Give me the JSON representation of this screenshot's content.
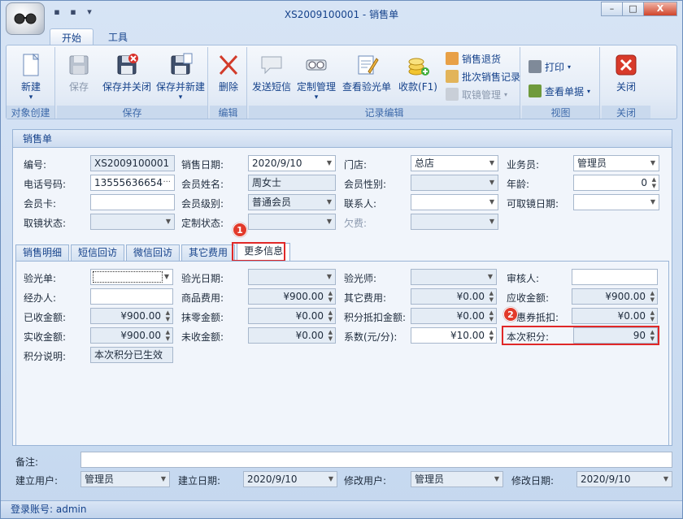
{
  "window": {
    "title": "XS2009100001 - 销售单",
    "min_label": "▭",
    "max_label": "□",
    "close_label": "X"
  },
  "ribbon_tabs": [
    "开始",
    "工具"
  ],
  "ribbon": {
    "groups": {
      "create": "对象创建",
      "save": "保存",
      "edit": "编辑",
      "record_edit": "记录编辑",
      "view": "视图",
      "close": "关闭"
    },
    "new_label": "新建",
    "save_label": "保存",
    "save_close_label": "保存并关闭",
    "save_new_label": "保存并新建",
    "delete_label": "删除",
    "send_sms_label": "发送短信",
    "custom_mgmt_label": "定制管理",
    "view_optometry_label": "查看验光单",
    "receive_label": "收款(F1)",
    "sales_return_label": "销售退货",
    "batch_sales_label": "批次销售记录",
    "cancel_pickup_label": "取镜管理",
    "print_label": "打印",
    "view_doc_label": "查看单据",
    "close_label": "关闭"
  },
  "panel_title": "销售单",
  "header_fields": {
    "code_label": "编号:",
    "code_value": "XS2009100001",
    "sale_date_label": "销售日期:",
    "sale_date_value": "2020/9/10",
    "store_label": "门店:",
    "store_value": "总店",
    "salesman_label": "业务员:",
    "salesman_value": "管理员",
    "phone_label": "电话号码:",
    "phone_value": "13555636654",
    "member_name_label": "会员姓名:",
    "member_name_value": "周女士",
    "member_gender_label": "会员性别:",
    "member_gender_value": "",
    "age_label": "年龄:",
    "age_value": "0",
    "member_card_label": "会员卡:",
    "member_level_label": "会员级别:",
    "member_level_value": "普通会员",
    "contact_label": "联系人:",
    "pickup_date_label": "可取镜日期:",
    "pickup_status_label": "取镜状态:",
    "custom_status_label": "定制状态:",
    "owed_label": "欠费:"
  },
  "tabs": [
    "销售明细",
    "短信回访",
    "微信回访",
    "其它费用",
    "更多信息"
  ],
  "more_info": {
    "optometry_label": "验光单:",
    "optometry_date_label": "验光日期:",
    "optometrist_label": "验光师:",
    "reviewer_label": "审核人:",
    "handler_label": "经办人:",
    "product_fee_label": "商品费用:",
    "product_fee_value": "¥900.00",
    "other_fee_label": "其它费用:",
    "other_fee_value": "¥0.00",
    "receivable_label": "应收金额:",
    "receivable_value": "¥900.00",
    "received_label": "已收金额:",
    "received_value": "¥900.00",
    "rounding_label": "抹零金额:",
    "rounding_value": "¥0.00",
    "points_deduct_label": "积分抵扣金额:",
    "points_deduct_value": "¥0.00",
    "coupon_label": "惠券抵扣:",
    "coupon_value": "¥0.00",
    "actual_label": "实收金额:",
    "actual_value": "¥900.00",
    "unpaid_label": "未收金额:",
    "unpaid_value": "¥0.00",
    "coef_label": "系数(元/分):",
    "coef_value": "¥10.00",
    "points_label": "本次积分:",
    "points_value": "90",
    "points_note_label": "积分说明:",
    "points_note_value": "本次积分已生效"
  },
  "footer": {
    "remark_label": "备注:",
    "created_by_label": "建立用户:",
    "created_by_value": "管理员",
    "created_date_label": "建立日期:",
    "created_date_value": "2020/9/10",
    "modified_by_label": "修改用户:",
    "modified_by_value": "管理员",
    "modified_date_label": "修改日期:",
    "modified_date_value": "2020/9/10"
  },
  "markers": [
    "1",
    "2"
  ],
  "status": "登录账号: admin",
  "colors": {
    "accent": "#15428b",
    "highlight": "#e02828",
    "marker": "#e23a2b"
  }
}
